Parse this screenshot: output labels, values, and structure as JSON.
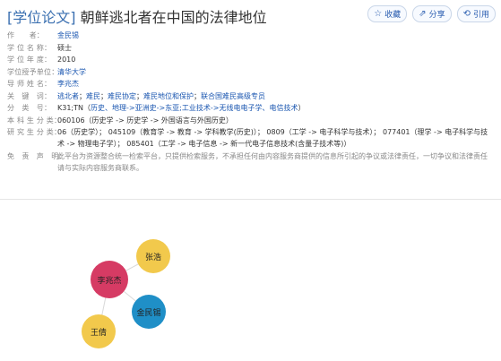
{
  "header": {
    "tag": "[学位论文]",
    "title": "朝鲜逃北者在中国的法律地位",
    "actions": {
      "favorite": "收藏",
      "share": "分享",
      "cite": "引用"
    }
  },
  "meta": {
    "author": {
      "label": "作　　者：",
      "value": "金民锡"
    },
    "degree": {
      "label": "学 位 名 称：",
      "value": "硕士"
    },
    "year": {
      "label": "学 位 年 度：",
      "value": "2010"
    },
    "school": {
      "label": "学位授予单位：",
      "value": "清华大学"
    },
    "advisor": {
      "label": "导 师 姓 名：",
      "value": "李兆杰"
    },
    "keywords": {
      "label": "关　键　词：",
      "items": [
        "逃北者",
        "难民",
        "难民协定",
        "难民地位和保护",
        "联合国难民高级专员"
      ]
    },
    "classification": {
      "label": "分　类　号：",
      "prefix": "K31;TN（",
      "items": [
        "历史、地理->亚洲史->东亚;工业技术->无线电电子学、电信技术"
      ],
      "suffix": "）"
    },
    "undergrad": {
      "label": "本 科 生 分 类：",
      "value": "060106（历史学 -> 历史学 -> 外国语言与外国历史）"
    },
    "grad": {
      "label": "研 究 生 分 类：",
      "value": "06（历史学）； 045109（教育学 -> 教育 -> 学科教学(历史)）； 0809（工学 -> 电子科学与技术）； 077401（理学 -> 电子科学与技术 -> 物理电子学）； 085401（工学 -> 电子信息 -> 新一代电子信息技术(含量子技术等)）"
    },
    "disclaimer": {
      "label": "免　责　声　明：",
      "value": "此平台为资源整合统一检索平台，只提供检索服务，不承担任何由内容服务商提供的信息所引起的争议或法律责任，一切争议和法律责任请与实际内容服务商联系。"
    }
  },
  "graph": {
    "nodes": [
      {
        "id": "li",
        "label": "李兆杰",
        "color": "#d63b64"
      },
      {
        "id": "zhang",
        "label": "张浩",
        "color": "#f2c94c"
      },
      {
        "id": "jin",
        "label": "金民锡",
        "color": "#1f8fc7"
      },
      {
        "id": "wang",
        "label": "王倩",
        "color": "#f2c94c"
      }
    ],
    "edges": [
      [
        "li",
        "zhang"
      ],
      [
        "li",
        "jin"
      ],
      [
        "li",
        "wang"
      ]
    ]
  }
}
